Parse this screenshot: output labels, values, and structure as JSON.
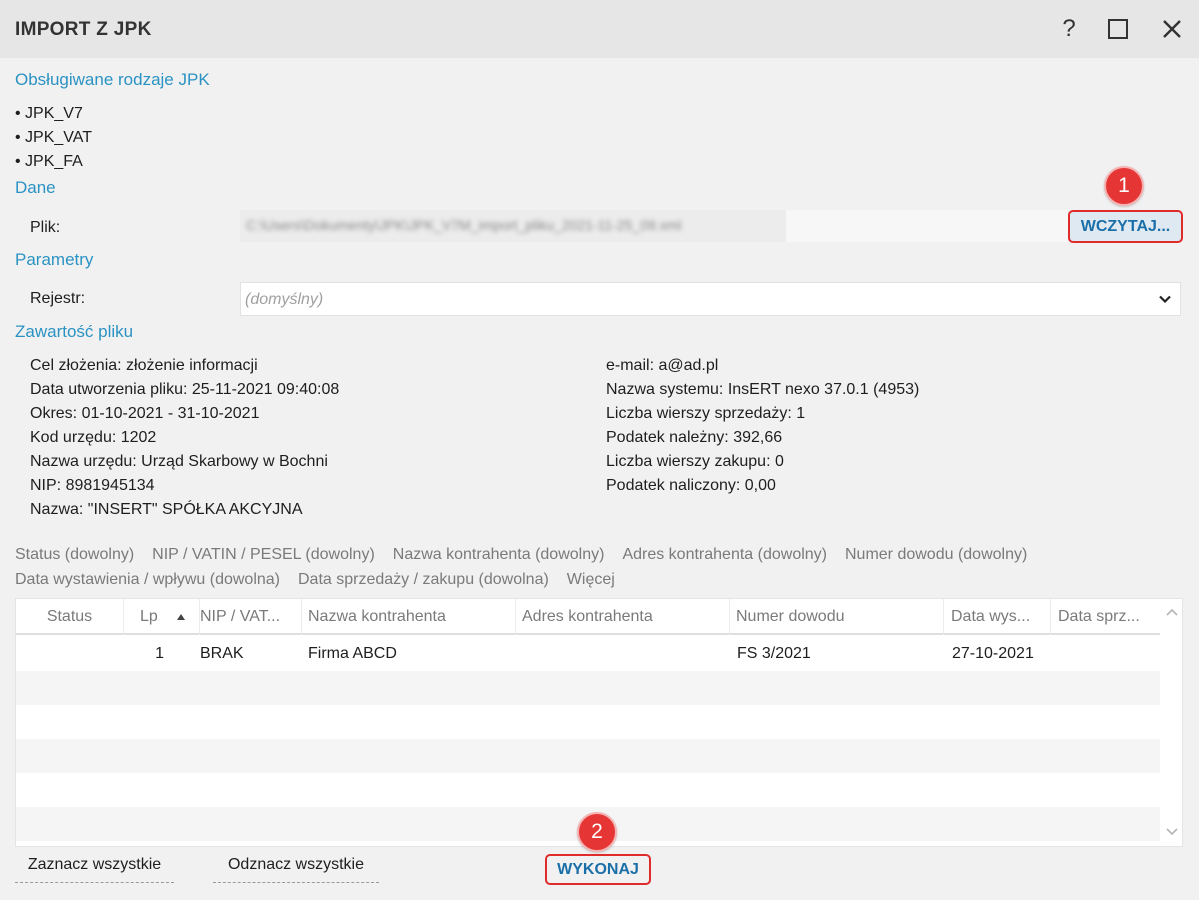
{
  "window": {
    "title": "IMPORT Z JPK",
    "help_label": "?"
  },
  "supported": {
    "heading": "Obsługiwane rodzaje JPK",
    "items": [
      "• JPK_V7",
      "• JPK_VAT",
      "• JPK_FA"
    ]
  },
  "dane": {
    "heading": "Dane",
    "file_label": "Plik:",
    "file_value": "C:\\Users\\Dokumenty\\JPK\\JPK_V7M_import_pliku_2021-11-25_09.xml",
    "load_button": "WCZYTAJ...",
    "badge": "1"
  },
  "parametry": {
    "heading": "Parametry",
    "register_label": "Rejestr:",
    "register_value": "(domyślny)"
  },
  "contents": {
    "heading": "Zawartość pliku",
    "left": [
      "Cel złożenia: złożenie informacji",
      "Data utworzenia pliku: 25-11-2021 09:40:08",
      "Okres: 01-10-2021 - 31-10-2021",
      "Kod urzędu: 1202",
      "Nazwa urzędu: Urząd Skarbowy w Bochni",
      "NIP: 8981945134",
      "Nazwa: \"INSERT\" SPÓŁKA AKCYJNA"
    ],
    "right": [
      "e-mail: a@ad.pl",
      "Nazwa systemu: InsERT nexo 37.0.1 (4953)",
      "Liczba wierszy sprzedaży: 1",
      "Podatek należny: 392,66",
      "Liczba wierszy zakupu: 0",
      "Podatek naliczony: 0,00"
    ]
  },
  "filters": {
    "row1": [
      "Status (dowolny)",
      "NIP / VATIN / PESEL (dowolny)",
      "Nazwa kontrahenta (dowolny)",
      "Adres kontrahenta (dowolny)",
      "Numer dowodu (dowolny)"
    ],
    "row2": [
      "Data wystawienia / wpływu (dowolna)",
      "Data sprzedaży / zakupu (dowolna)",
      "Więcej"
    ]
  },
  "grid": {
    "columns": [
      "Status",
      "Lp",
      "NIP / VAT...",
      "Nazwa kontrahenta",
      "Adres kontrahenta",
      "Numer dowodu",
      "Data wys...",
      "Data sprz..."
    ],
    "rows": [
      {
        "status": "",
        "lp": "1",
        "nip": "BRAK",
        "name": "Firma ABCD",
        "address": "",
        "doc": "FS 3/2021",
        "issue_date": "27-10-2021",
        "sale_date": ""
      }
    ]
  },
  "footer": {
    "select_all": "Zaznacz wszystkie",
    "deselect_all": "Odznacz wszystkie",
    "execute": "WYKONAJ",
    "badge": "2"
  },
  "colors": {
    "accent": "#2b93c3",
    "button_text": "#1b6fa8",
    "highlight": "#e02b2b"
  }
}
